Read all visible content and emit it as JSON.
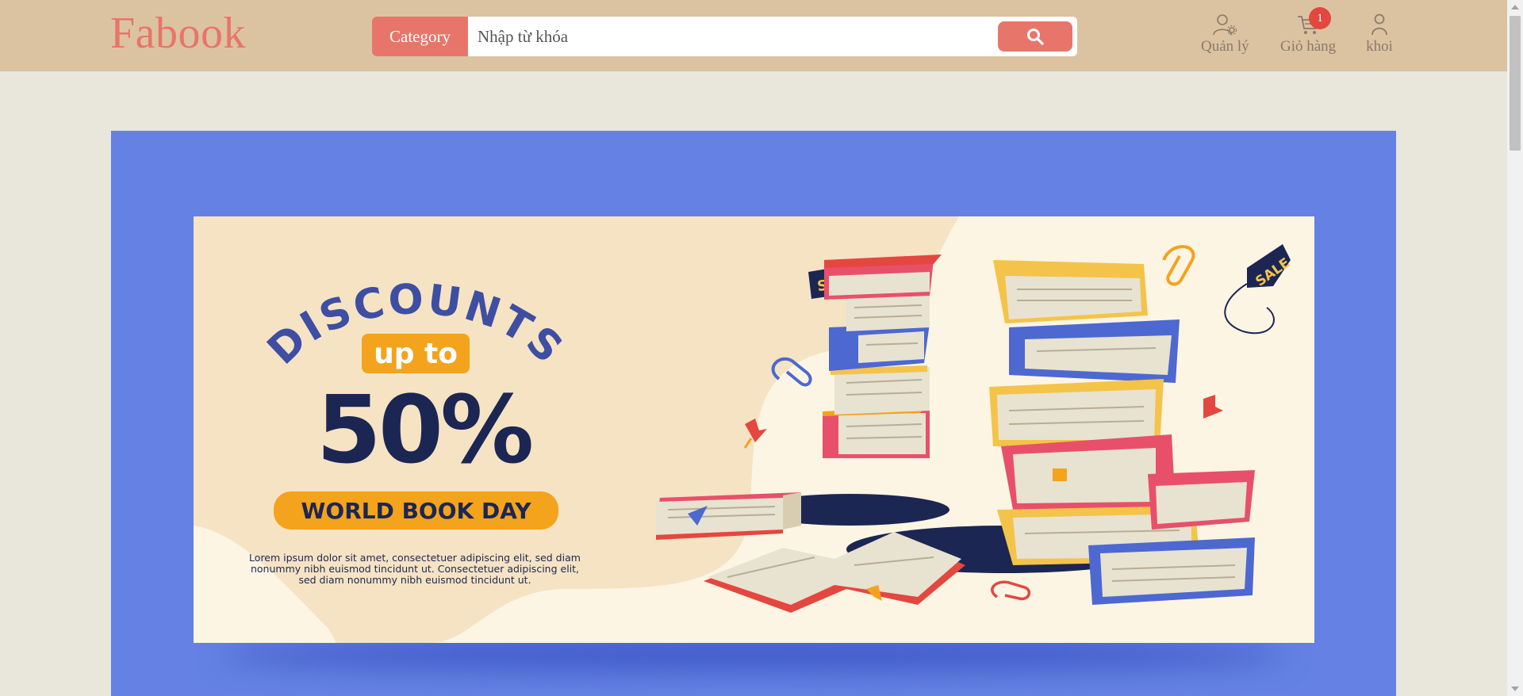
{
  "header": {
    "logo": "Fabook",
    "category_label": "Category",
    "search_placeholder": "Nhập từ khóa",
    "admin_label": "Quản lý",
    "cart_label": "Giỏ hàng",
    "cart_count": "1",
    "user_label": "khoi"
  },
  "banner": {
    "headline": "DISCOUNTS",
    "up_to": "up to",
    "percent": "50%",
    "event": "WORLD BOOK DAY",
    "body": "Lorem ipsum dolor sit amet, consectetuer adipiscing elit, sed diam nonummy nibh euismod tincidunt ut. Consectetuer adipiscing elit, sed diam nonummy nibh euismod tincidunt ut.",
    "sale_tag": "SALE"
  },
  "colors": {
    "header_bg": "#dbc3a1",
    "accent": "#e8756a",
    "banner_bg": "#6481e3",
    "page_bg": "#e9e6dc"
  }
}
